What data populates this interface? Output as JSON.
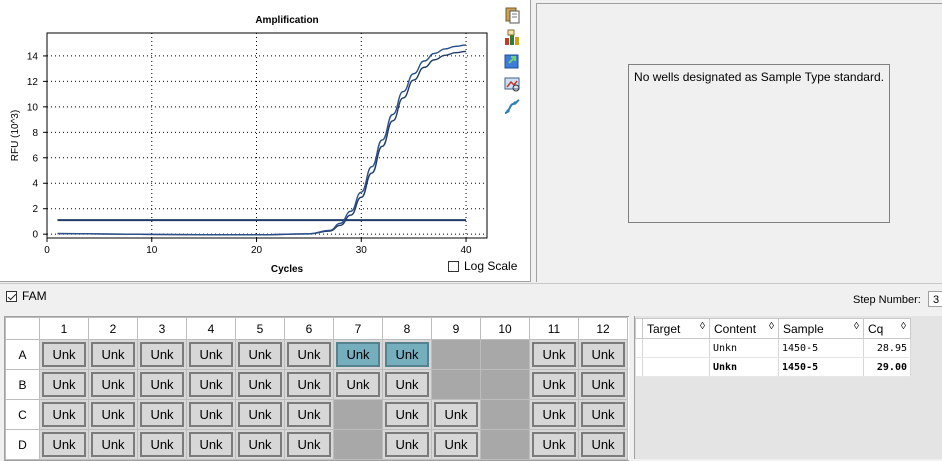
{
  "chart_data": {
    "type": "line",
    "title": "Amplification",
    "xlabel": "Cycles",
    "ylabel": "RFU (10^3)",
    "xlim": [
      0,
      42
    ],
    "ylim": [
      -0.3,
      15.8
    ],
    "x_ticks": [
      0,
      10,
      20,
      30,
      40
    ],
    "y_ticks": [
      0,
      2,
      4,
      6,
      8,
      10,
      12,
      14
    ],
    "grid": true,
    "threshold": 1.1,
    "series": [
      {
        "color": "#1f3b66",
        "x": [
          1,
          5,
          10,
          15,
          20,
          25,
          27,
          28,
          29,
          30,
          31,
          32,
          33,
          34,
          35,
          36,
          37,
          38,
          39,
          40
        ],
        "y": [
          0.05,
          0.02,
          -0.02,
          -0.04,
          -0.05,
          0.02,
          0.25,
          0.7,
          1.5,
          2.9,
          4.8,
          6.9,
          8.9,
          10.7,
          12.1,
          13.1,
          13.7,
          14.05,
          14.25,
          14.35
        ]
      },
      {
        "color": "#2a5089",
        "x": [
          1,
          5,
          10,
          15,
          20,
          25,
          27,
          28,
          29,
          30,
          31,
          32,
          33,
          34,
          35,
          36,
          37,
          38,
          39,
          40
        ],
        "y": [
          0.05,
          0.02,
          -0.02,
          -0.04,
          -0.05,
          0.03,
          0.3,
          0.85,
          1.8,
          3.3,
          5.3,
          7.4,
          9.4,
          11.2,
          12.6,
          13.6,
          14.2,
          14.55,
          14.75,
          14.85
        ]
      }
    ]
  },
  "amplification": {
    "title": "Amplification",
    "xlabel": "Cycles",
    "ylabel": "RFU (10^3)",
    "x_ticks": [
      "0",
      "10",
      "20",
      "30",
      "40"
    ],
    "y_ticks": [
      "0",
      "2",
      "4",
      "6",
      "8",
      "10",
      "12",
      "14"
    ],
    "log_scale_label": "Log Scale"
  },
  "toolbar": {
    "icons": [
      "copy-icon",
      "export-chart-icon",
      "export-data-icon",
      "print-chart-icon",
      "trace-style-icon"
    ]
  },
  "standard_curve": {
    "message": "No wells designated as Sample Type standard."
  },
  "fluor": {
    "label": "FAM",
    "checked": true
  },
  "step": {
    "label": "Step Number:",
    "value": "3"
  },
  "plate": {
    "columns": [
      "1",
      "2",
      "3",
      "4",
      "5",
      "6",
      "7",
      "8",
      "9",
      "10",
      "11",
      "12"
    ],
    "rows": [
      {
        "label": "A",
        "wells": [
          "Unk",
          "Unk",
          "Unk",
          "Unk",
          "Unk",
          "Unk",
          "Unk*",
          "Unk*",
          "",
          "",
          "Unk",
          "Unk"
        ]
      },
      {
        "label": "B",
        "wells": [
          "Unk",
          "Unk",
          "Unk",
          "Unk",
          "Unk",
          "Unk",
          "Unk",
          "Unk",
          "",
          "",
          "Unk",
          "Unk"
        ]
      },
      {
        "label": "C",
        "wells": [
          "Unk",
          "Unk",
          "Unk",
          "Unk",
          "Unk",
          "Unk",
          "",
          "Unk",
          "Unk",
          "",
          "Unk",
          "Unk"
        ]
      },
      {
        "label": "D",
        "wells": [
          "Unk",
          "Unk",
          "Unk",
          "Unk",
          "Unk",
          "Unk",
          "",
          "Unk",
          "Unk",
          "",
          "Unk",
          "Unk"
        ]
      }
    ]
  },
  "results": {
    "headers": [
      "Target",
      "Content",
      "Sample",
      "Cq"
    ],
    "rows": [
      {
        "target": "",
        "content": "Unkn",
        "sample": "1450-5",
        "cq": "28.95"
      },
      {
        "target": "",
        "content": "Unkn",
        "sample": "1450-5",
        "cq": "29.00"
      }
    ]
  }
}
